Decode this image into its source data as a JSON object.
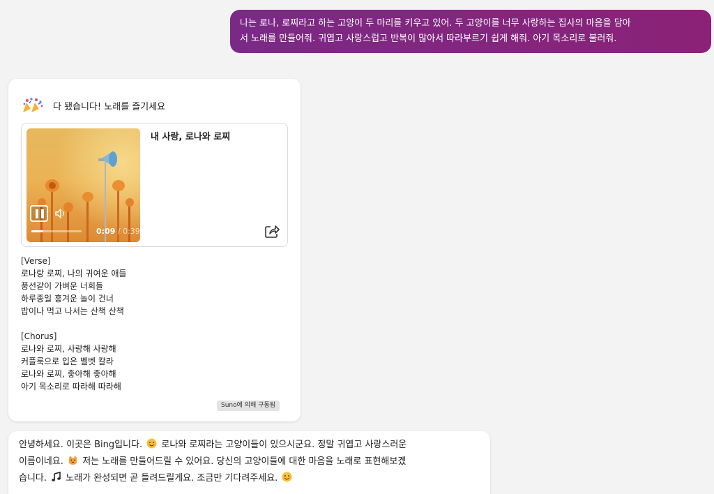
{
  "user_message": {
    "lines": [
      "나는 로나, 로찌라고 하는 고양이 두 마리를 키우고 있어. 두 고양이를 너무 사랑하는 집사의 마음을 담아",
      "서 노래를 만들어줘. 귀엽고 사랑스럽고 반복이 많아서 따라부르기 쉽게 해줘. 아기 목소리로 불러줘."
    ]
  },
  "song_card": {
    "header": "다 됐습니다! 노래를 즐기세요",
    "header_icon": "party-popper-icon",
    "song_title": "내 사랑, 로나와 로찌",
    "current_time": "0:09",
    "time_separator": " / ",
    "total_time": "0:39",
    "progress": 0.23,
    "lyrics": [
      {
        "section": "[Verse]",
        "lines": [
          "로나랑 로찌, 나의 귀여운 애들",
          "풍선같이 가벼운 너희들",
          "하루종일 흥겨운 놀이 건너",
          "밥이나 먹고 나서는 산책 산책"
        ]
      },
      {
        "section": "[Chorus]",
        "lines": [
          "로나와 로찌, 사랑해 사랑해",
          "커플룩으로 입은 벨벳 칼라",
          "로나와 로찌, 좋아해 좋아해",
          "아기 목소리로 따라해 따라해"
        ]
      }
    ],
    "badge": "Suno에 의해 구동됨"
  },
  "bot_message": {
    "line1_a": "안녕하세요. 이곳은 Bing입니다.",
    "line1_b": "로나와 로찌라는 고양이들이 있으시군요. 정말 귀엽고 사랑스러운",
    "line2_a": "이름이네요.",
    "line2_b": "저는 노래를 만들어드릴 수 있어요. 당신의 고양이들에 대한 마음을 노래로 표현해보겠",
    "line3_a": "습니다.",
    "line3_b": "노래가 완성되면 곧 들려드릴게요. 조금만 기다려주세요.",
    "icons": [
      "smile-emoji-icon",
      "cat-emoji-icon",
      "music-note-icon",
      "smile-emoji-icon"
    ]
  },
  "colors": {
    "user_bubble_start": "#7a2a86",
    "user_bubble_end": "#8b2277",
    "background": "#f3f3f3"
  }
}
